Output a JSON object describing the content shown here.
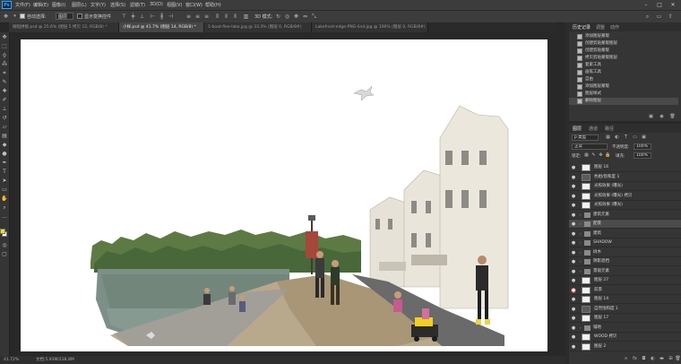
{
  "app": {
    "logo": "Ps",
    "menu": [
      "文件(F)",
      "编辑(E)",
      "图像(I)",
      "图层(L)",
      "文字(Y)",
      "选择(S)",
      "滤镜(T)",
      "3D(D)",
      "视图(V)",
      "窗口(W)",
      "帮助(H)"
    ],
    "window_controls": [
      "minimize-icon",
      "maximize-icon",
      "close-icon"
    ]
  },
  "options": {
    "auto_select_label": "自动选择:",
    "auto_select_value": "图层",
    "show_transform_label": "显示变换控件",
    "mode_3d_label": "3D 模式:"
  },
  "tabs": [
    {
      "label": "缩短拼接.psd @ 25.6% (图层 5 拷贝 12, RGB/8) *",
      "active": false
    },
    {
      "label": "小样.psd @ 41.7% (图层 14, RGB/8) *",
      "active": true
    },
    {
      "label": "1-boat-flee-lake.jpg @ 33.3% (图层 0, RGB/8#)",
      "active": false
    },
    {
      "label": "Lakefront-edge-PNG-lind.jpg @ 100% (图层 0, RGB/8#)",
      "active": false
    }
  ],
  "tools": [
    "move-icon",
    "marquee-icon",
    "lasso-icon",
    "magic-wand-icon",
    "crop-icon",
    "eyedropper-icon",
    "healing-icon",
    "brush-icon",
    "stamp-icon",
    "history-brush-icon",
    "eraser-icon",
    "gradient-icon",
    "blur-icon",
    "dodge-icon",
    "pen-icon",
    "type-icon",
    "path-select-icon",
    "shape-icon",
    "hand-icon",
    "zoom-icon",
    "more-icon"
  ],
  "colors": {
    "foreground": "#f0e020",
    "background": "#ffffff",
    "accent": "#c0392b"
  },
  "status": {
    "zoom": "41.72%",
    "doc_info": "文档:5.93M/238.8M"
  },
  "history_panel": {
    "tabs": [
      "历史记录",
      "调整",
      "动作"
    ],
    "items": [
      "添加图层蒙版",
      "创建剪贴蒙版图层",
      "创建剪贴蒙版",
      "拷贝剪贴蒙版图层",
      "套索工具",
      "画笔工具",
      "自由",
      "添加图层蒙版",
      "图层样式",
      "删除图层"
    ]
  },
  "layers_panel": {
    "tabs": [
      "图层",
      "通道",
      "路径"
    ],
    "kind_filter": "p 类型",
    "blend_mode": "正常",
    "opacity_label": "不透明度:",
    "opacity_value": "100%",
    "lock_label": "锁定:",
    "fill_label": "填充:",
    "fill_value": "100%",
    "layers": [
      {
        "name": "图层 16",
        "type": "layer",
        "visible": true
      },
      {
        "name": "色相/饱和度 1",
        "type": "adjust",
        "visible": true
      },
      {
        "name": "光照效果 (曝光)",
        "type": "layer",
        "visible": true
      },
      {
        "name": "光照效果 (曝光) 拷贝",
        "type": "layer",
        "visible": true
      },
      {
        "name": "光照效果 (曝光)",
        "type": "layer",
        "visible": true
      },
      {
        "name": "建筑元素",
        "type": "group",
        "visible": true
      },
      {
        "name": "配景",
        "type": "group",
        "visible": true,
        "selected": true
      },
      {
        "name": "建筑",
        "type": "group",
        "visible": true
      },
      {
        "name": "SHADOW",
        "type": "group",
        "visible": true
      },
      {
        "name": "树木",
        "type": "group",
        "visible": true
      },
      {
        "name": "阴影遮挡",
        "type": "group",
        "visible": true
      },
      {
        "name": "景观元素",
        "type": "group",
        "visible": true
      },
      {
        "name": "图层 27",
        "type": "layer",
        "visible": true
      },
      {
        "name": "前景",
        "type": "layer",
        "visible": true,
        "red": true
      },
      {
        "name": "图层 14",
        "type": "layer",
        "visible": true
      },
      {
        "name": "自然饱和度 1",
        "type": "adjust",
        "visible": true
      },
      {
        "name": "图层 17",
        "type": "layer",
        "visible": true
      },
      {
        "name": "铺地",
        "type": "group",
        "visible": true
      },
      {
        "name": "WOOD 拷贝",
        "type": "layer",
        "visible": true
      },
      {
        "name": "图层 2",
        "type": "layer",
        "visible": true
      }
    ]
  }
}
